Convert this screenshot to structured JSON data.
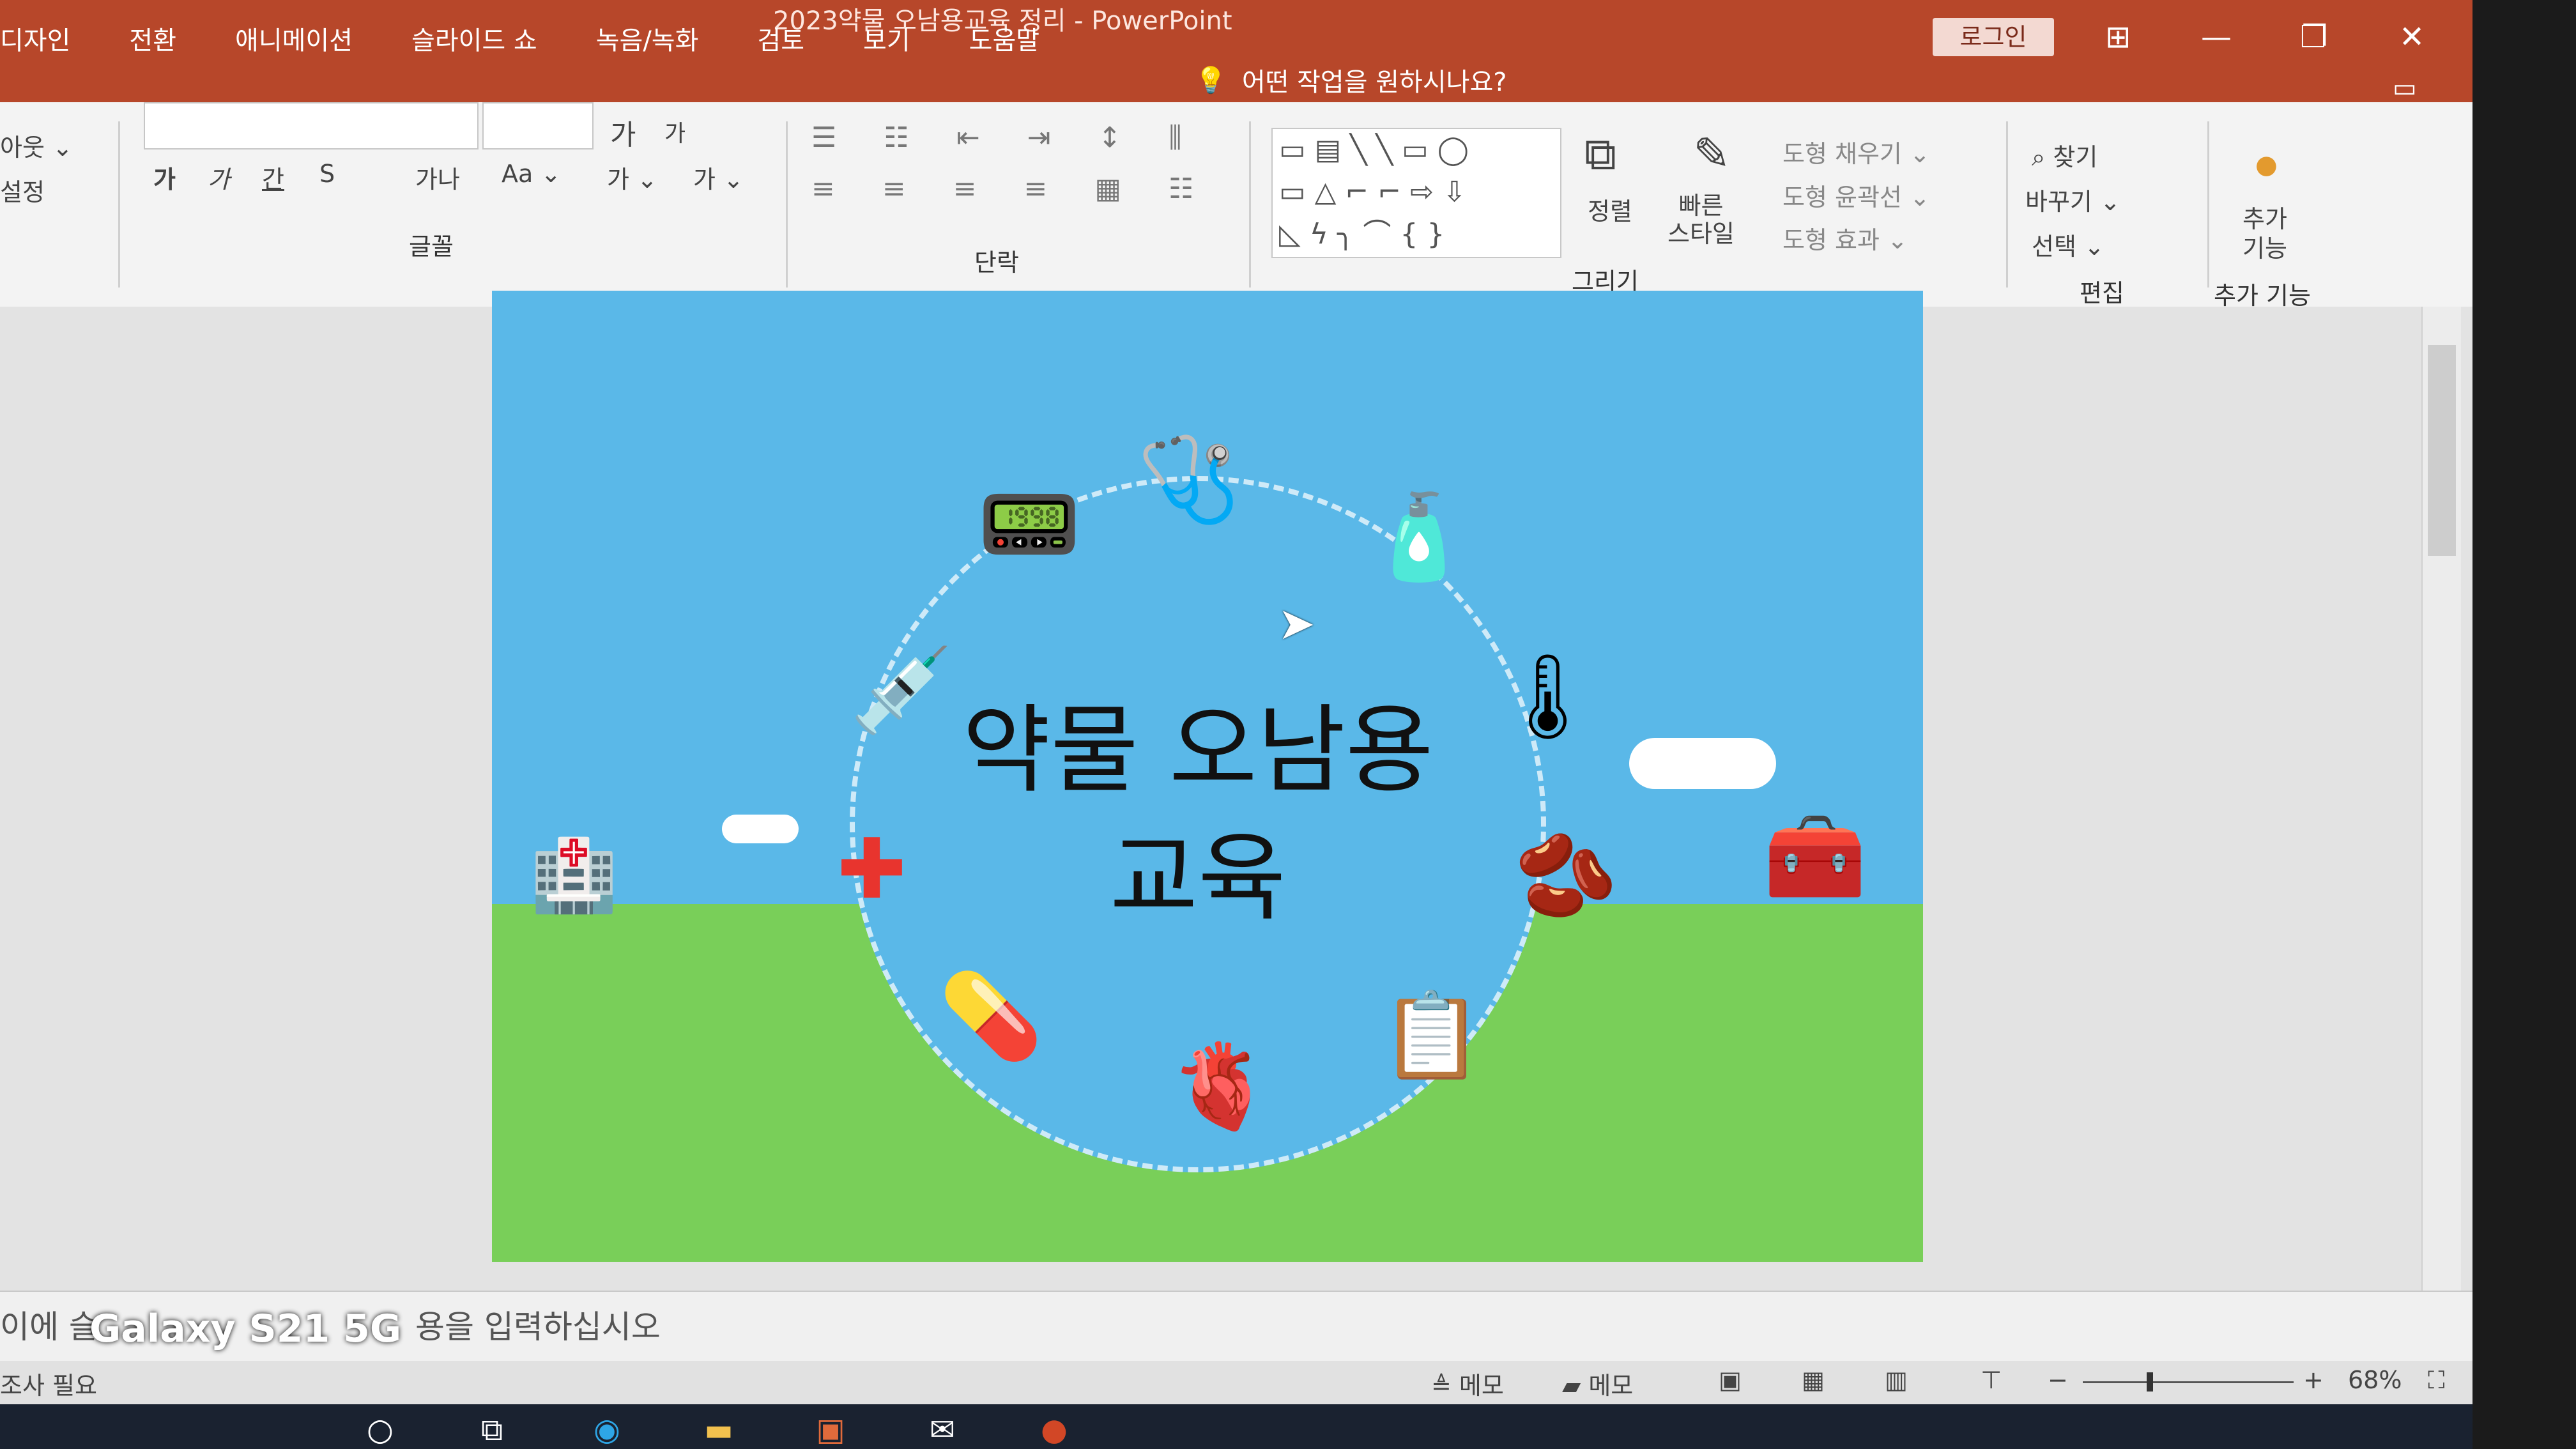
{
  "window": {
    "title": "2023약물 오남용교육 정리  -  PowerPoint",
    "login_label": "로그인",
    "controls": {
      "ribbon_display": "⊞",
      "minimize": "—",
      "restore": "❐",
      "close": "✕"
    }
  },
  "tabs": [
    {
      "label": "디자인"
    },
    {
      "label": "전환"
    },
    {
      "label": "애니메이션"
    },
    {
      "label": "슬라이드 쇼"
    },
    {
      "label": "녹음/녹화"
    },
    {
      "label": "검토"
    },
    {
      "label": "보기"
    },
    {
      "label": "도움말"
    }
  ],
  "tell_me": {
    "icon": "lightbulb-icon",
    "label": "어떤 작업을 원하시나요?"
  },
  "ribbon": {
    "slides_group": {
      "layout": "아웃 ⌄",
      "reset": "설정"
    },
    "font_group": {
      "label": "글꼴",
      "grow": "가",
      "shrink": "가",
      "bold": "가",
      "italic": "가",
      "underline": "간",
      "strike": "S",
      "spacing": "가나",
      "case": "Aa ⌄",
      "highlight": "가 ⌄",
      "font_color": "가 ⌄"
    },
    "paragraph_group": {
      "label": "단락"
    },
    "drawing_group": {
      "label": "그리기",
      "arrange": "정렬",
      "quick_styles": "빠른\n스타일",
      "shape_fill": "도형 채우기 ⌄",
      "shape_outline": "도형 윤곽선 ⌄",
      "shape_effects": "도형 효과 ⌄"
    },
    "editing_group": {
      "label": "편집",
      "find": "찾기",
      "replace": "바꾸기 ⌄",
      "select": "선택 ⌄"
    },
    "addins_group": {
      "label": "추가 기능",
      "button": "추가\n기능"
    }
  },
  "slide": {
    "title_line1": "약물 오남용",
    "title_line2": "교육",
    "icons": [
      "stethoscope-icon",
      "pill-bottle-icon",
      "thermometer-icon",
      "kidney-icon",
      "medical-chart-icon",
      "heart-organ-icon",
      "capsule-icon",
      "red-cross-heart-icon",
      "syringe-icon",
      "heart-monitor-icon",
      "first-aid-kit-icon",
      "hospital-building-icon"
    ]
  },
  "notes": {
    "placeholder_left": "이에 슬",
    "placeholder_right": "용을 입력하십시오"
  },
  "status": {
    "left": "조사 필요",
    "notes_btn": "메모",
    "comments_btn": "메모",
    "zoom_minus": "−",
    "zoom_plus": "+",
    "zoom": "68%"
  },
  "overlay": {
    "watermark": "Galaxy S21 5G"
  }
}
